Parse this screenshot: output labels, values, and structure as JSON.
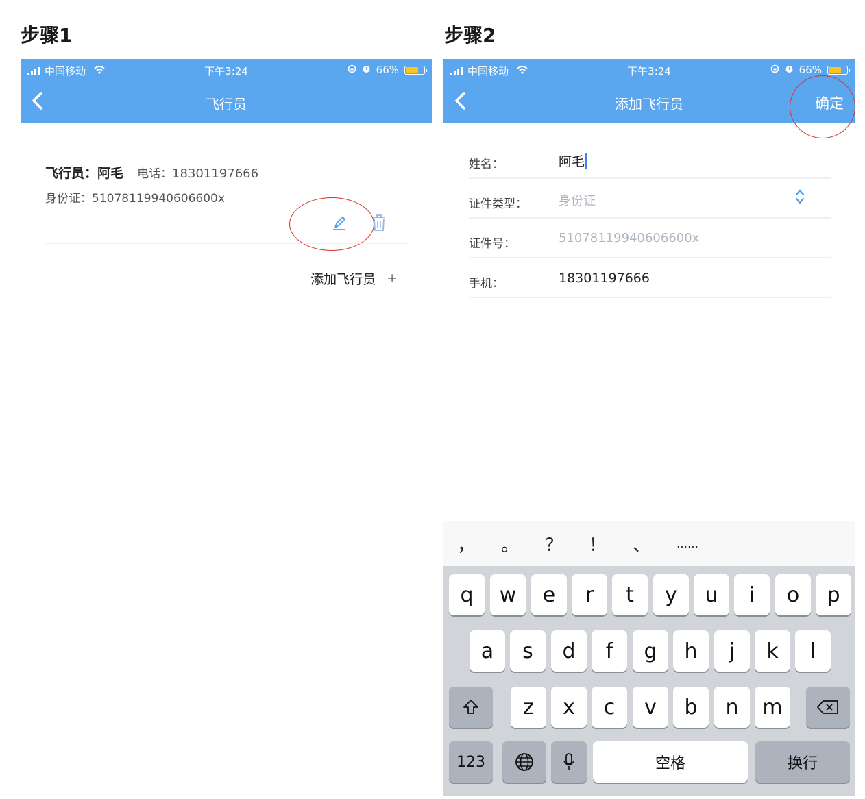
{
  "step1": {
    "label": "步骤1",
    "statusbar": {
      "carrier": "中国移动",
      "time": "下午3:24",
      "battery": "66%"
    },
    "nav": {
      "back": "‹",
      "title": "飞行员"
    },
    "pilot": {
      "name_label": "飞行员：",
      "name": "阿毛",
      "phone_label": "电话：",
      "phone": "18301197666",
      "id_label": "身份证：",
      "id_number": "51078119940606600x"
    },
    "icons": {
      "edit": "pencil-icon",
      "delete": "trash-icon"
    },
    "add_pilot": {
      "label": "添加飞行员",
      "icon": "+"
    }
  },
  "step2": {
    "label": "步骤2",
    "statusbar": {
      "carrier": "中国移动",
      "time": "下午3:24",
      "battery": "66%"
    },
    "nav": {
      "back": "‹",
      "title": "添加飞行员",
      "confirm": "确定"
    },
    "form": {
      "name": {
        "label": "姓名：",
        "value": "阿毛"
      },
      "id_type": {
        "label": "证件类型：",
        "value": "身份证"
      },
      "id_number": {
        "label": "证件号：",
        "value": "51078119940606600x"
      },
      "mobile": {
        "label": "手机：",
        "value": "18301197666"
      }
    },
    "keyboard": {
      "suggestions": [
        "，",
        "。",
        "？",
        "！",
        "、",
        "……"
      ],
      "row1": [
        "q",
        "w",
        "e",
        "r",
        "t",
        "y",
        "u",
        "i",
        "o",
        "p"
      ],
      "row2": [
        "a",
        "s",
        "d",
        "f",
        "g",
        "h",
        "j",
        "k",
        "l"
      ],
      "row3": [
        "z",
        "x",
        "c",
        "v",
        "b",
        "n",
        "m"
      ],
      "numbers": "123",
      "space": "空格",
      "return": "换行"
    }
  },
  "colors": {
    "nav_blue": "#5aa7ef",
    "accent_blue": "#4a9ef0",
    "highlight_red": "#d9332b"
  }
}
